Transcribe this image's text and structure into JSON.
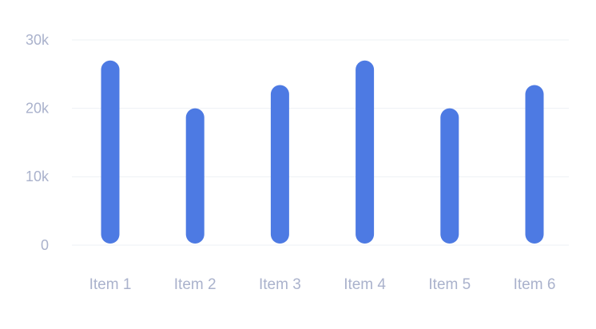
{
  "chart_data": {
    "type": "bar",
    "categories": [
      "Item 1",
      "Item 2",
      "Item 3",
      "Item 4",
      "Item 5",
      "Item 6"
    ],
    "values": [
      27000,
      20000,
      23400,
      27000,
      20000,
      23400
    ],
    "y_ticks": [
      {
        "value": 0,
        "label": "0"
      },
      {
        "value": 10000,
        "label": "10k"
      },
      {
        "value": 20000,
        "label": "20k"
      },
      {
        "value": 30000,
        "label": "30k"
      }
    ],
    "ylim": [
      0,
      30000
    ],
    "title": "",
    "xlabel": "",
    "ylabel": "",
    "grid": true,
    "legend": "none",
    "colors": {
      "bar": "#4d7ae3",
      "grid": "#eef0f5",
      "axis_text": "#aab2cc"
    }
  }
}
